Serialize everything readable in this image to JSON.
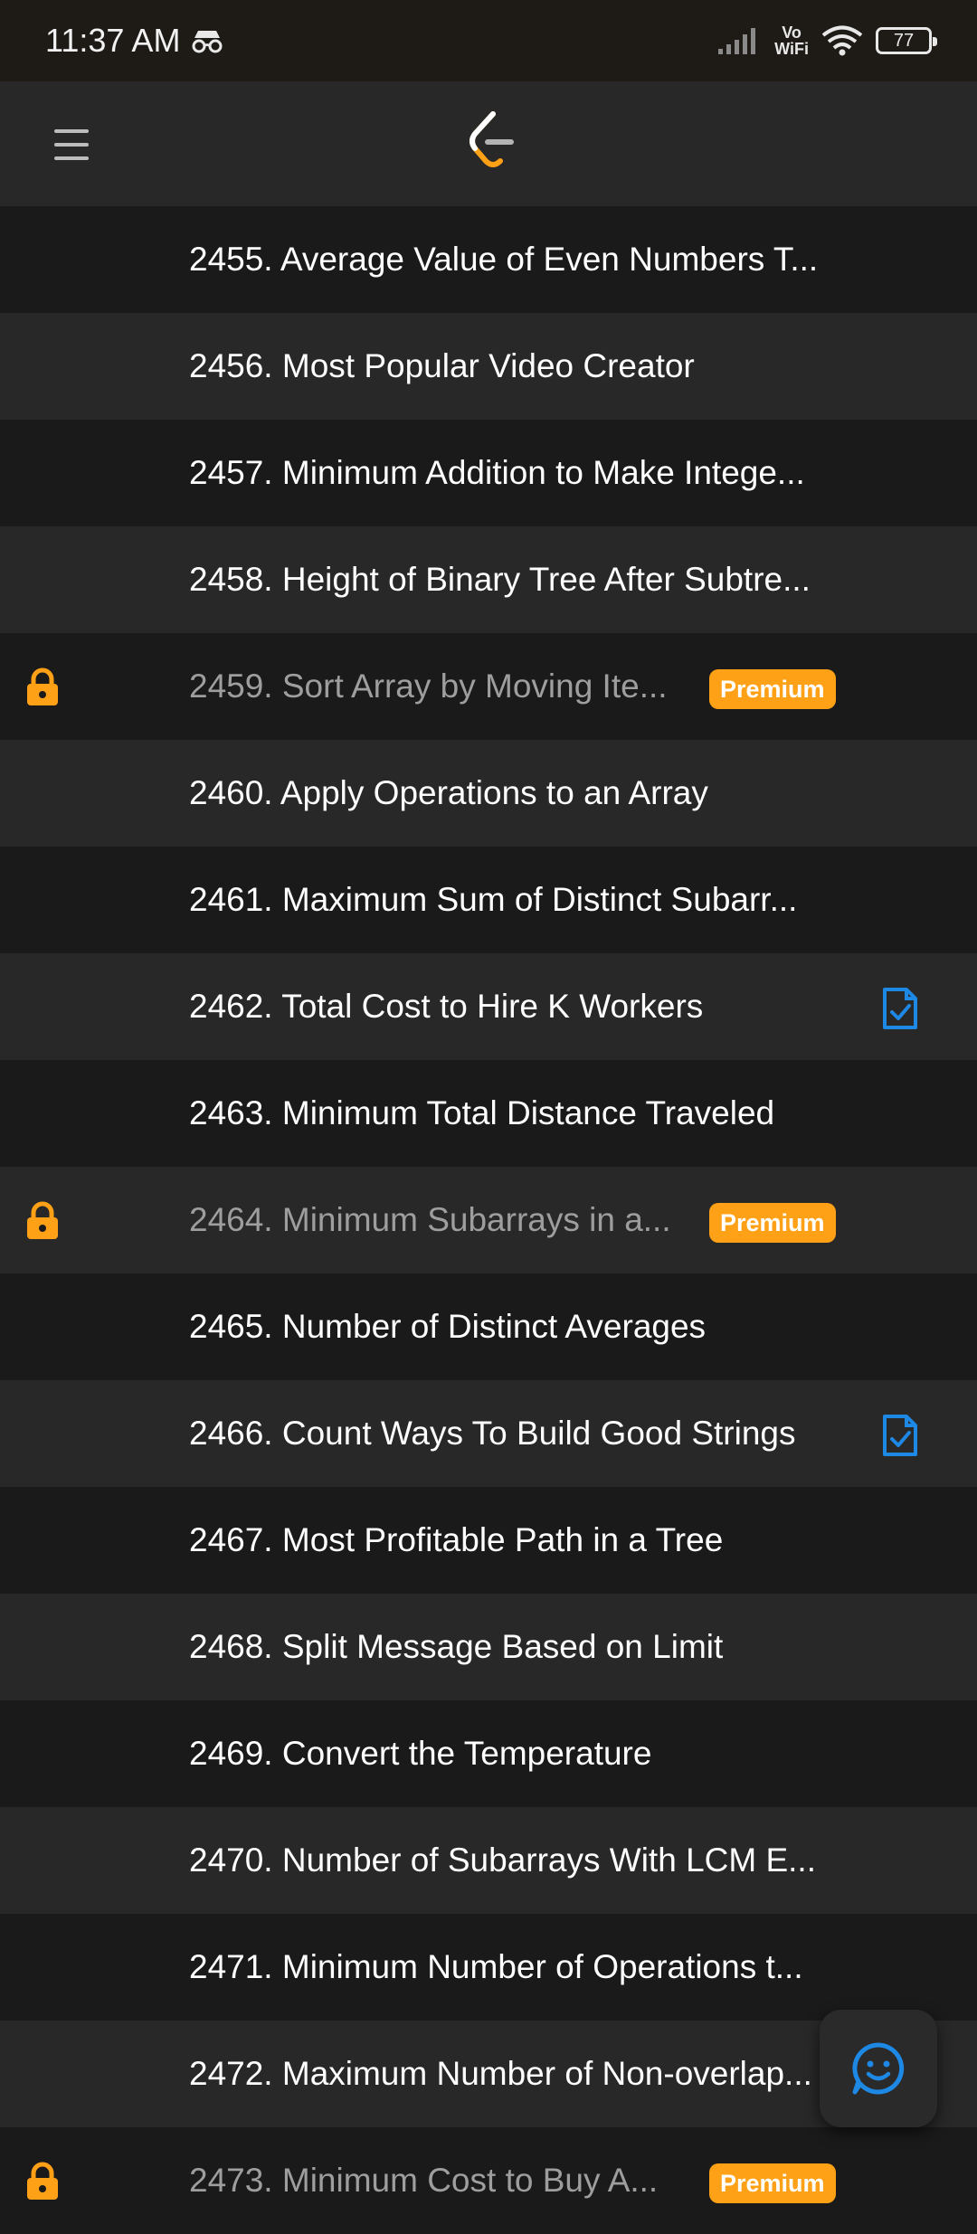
{
  "status_bar": {
    "time": "11:37 AM",
    "network_label": "Vo\nWiFi",
    "battery": "77"
  },
  "app_bar": {
    "menu_icon": "hamburger-menu-icon",
    "logo_icon": "leetcode-logo-icon"
  },
  "problems": [
    {
      "title": "2455. Average Value of Even Numbers T...",
      "locked": false,
      "premium": false,
      "solved": false
    },
    {
      "title": "2456. Most Popular Video Creator",
      "locked": false,
      "premium": false,
      "solved": false
    },
    {
      "title": "2457. Minimum Addition to Make Intege...",
      "locked": false,
      "premium": false,
      "solved": false
    },
    {
      "title": "2458. Height of Binary Tree After Subtre...",
      "locked": false,
      "premium": false,
      "solved": false
    },
    {
      "title": "2459. Sort Array by Moving Ite...",
      "locked": true,
      "premium": true,
      "solved": false
    },
    {
      "title": "2460. Apply Operations to an Array",
      "locked": false,
      "premium": false,
      "solved": false
    },
    {
      "title": "2461. Maximum Sum of Distinct Subarr...",
      "locked": false,
      "premium": false,
      "solved": false
    },
    {
      "title": "2462. Total Cost to Hire K Workers",
      "locked": false,
      "premium": false,
      "solved": true
    },
    {
      "title": "2463. Minimum Total Distance Traveled",
      "locked": false,
      "premium": false,
      "solved": false
    },
    {
      "title": "2464. Minimum Subarrays in a...",
      "locked": true,
      "premium": true,
      "solved": false
    },
    {
      "title": "2465. Number of Distinct Averages",
      "locked": false,
      "premium": false,
      "solved": false
    },
    {
      "title": "2466. Count Ways To Build Good Strings",
      "locked": false,
      "premium": false,
      "solved": true
    },
    {
      "title": "2467. Most Profitable Path in a Tree",
      "locked": false,
      "premium": false,
      "solved": false
    },
    {
      "title": "2468. Split Message Based on Limit",
      "locked": false,
      "premium": false,
      "solved": false
    },
    {
      "title": "2469. Convert the Temperature",
      "locked": false,
      "premium": false,
      "solved": false
    },
    {
      "title": "2470. Number of Subarrays With LCM E...",
      "locked": false,
      "premium": false,
      "solved": false
    },
    {
      "title": "2471. Minimum Number of Operations t...",
      "locked": false,
      "premium": false,
      "solved": false
    },
    {
      "title": "2472. Maximum Number of Non-overlap...",
      "locked": false,
      "premium": false,
      "solved": false
    },
    {
      "title": "2473. Minimum Cost to Buy A...",
      "locked": true,
      "premium": true,
      "solved": false
    }
  ],
  "premium_label": "Premium",
  "fab": {
    "icon": "feedback-smiley-icon"
  },
  "colors": {
    "accent": "#ffa116",
    "solved": "#1e88e5",
    "row_dark": "#1a1a1a",
    "row_light": "#282828"
  }
}
